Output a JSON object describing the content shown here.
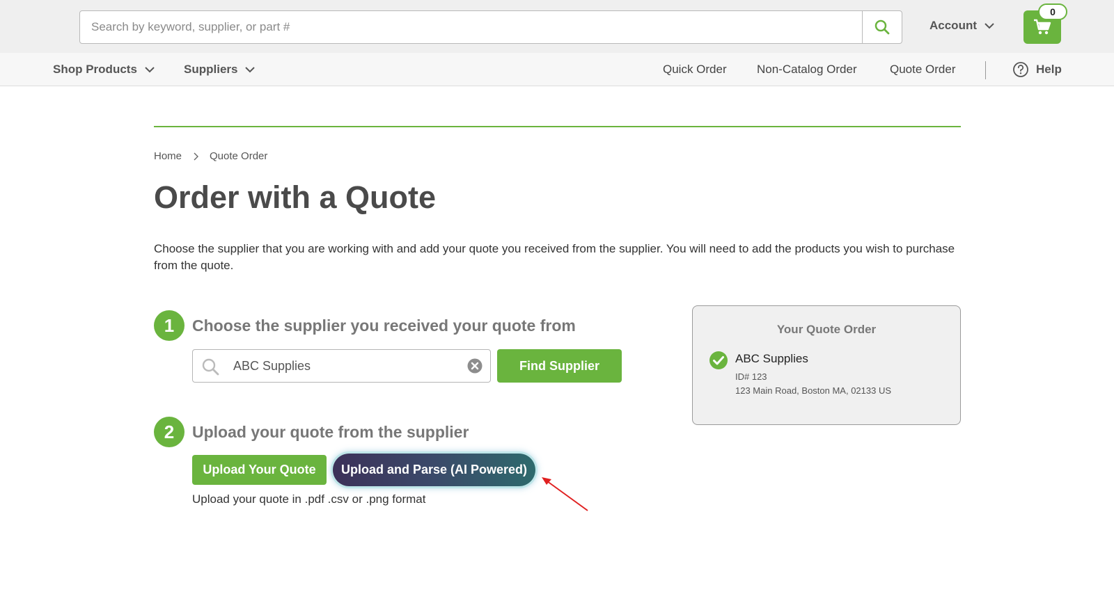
{
  "header": {
    "search": {
      "placeholder": "Search by keyword, supplier, or part #",
      "value": ""
    },
    "account_label": "Account",
    "cart_count": "0"
  },
  "nav": {
    "left": [
      {
        "label": "Shop Products"
      },
      {
        "label": "Suppliers"
      }
    ],
    "right": [
      {
        "label": "Quick Order"
      },
      {
        "label": "Non-Catalog Order"
      },
      {
        "label": "Quote Order"
      }
    ],
    "help_label": "Help"
  },
  "breadcrumb": {
    "home": "Home",
    "current": "Quote Order"
  },
  "page": {
    "title": "Order with a Quote",
    "intro": "Choose the supplier that you are working with and add your quote you received from the supplier. You will need to add the products you wish to purchase from the quote."
  },
  "step1": {
    "number": "1",
    "title": "Choose the supplier you received your quote from",
    "supplier_value": "ABC Supplies",
    "find_button": "Find Supplier"
  },
  "step2": {
    "number": "2",
    "title": "Upload your quote from the supplier",
    "upload_button": "Upload Your Quote",
    "ai_button": "Upload and Parse (AI Powered)",
    "hint": "Upload your quote in .pdf .csv or .png format"
  },
  "quote_card": {
    "title": "Your Quote Order",
    "supplier_name": "ABC Supplies",
    "supplier_id": "ID# 123",
    "address": "123 Main Road, Boston MA, 02133 US"
  },
  "colors": {
    "brand_green": "#6ab43e",
    "annotation_red": "#e02020"
  }
}
